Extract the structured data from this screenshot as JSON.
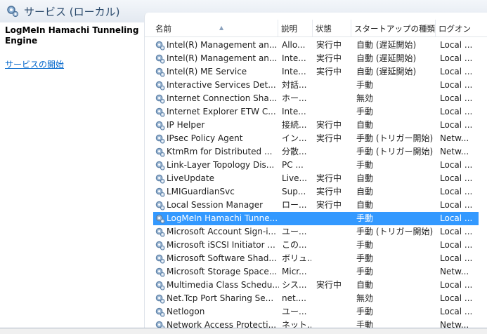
{
  "window": {
    "title": "サービス (ローカル)"
  },
  "left_pane": {
    "service_name": "LogMeIn Hamachi Tunneling Engine",
    "start_link": "サービスの開始"
  },
  "columns": {
    "name": "名前",
    "description": "説明",
    "state": "状態",
    "startup": "スタートアップの種類",
    "logon": "ログオン"
  },
  "services": [
    {
      "name": "Intel(R) Management an...",
      "desc": "Allo...",
      "state": "実行中",
      "startup": "自動 (遅延開始)",
      "logon": "Local ..."
    },
    {
      "name": "Intel(R) Management an...",
      "desc": "Inte...",
      "state": "実行中",
      "startup": "自動 (遅延開始)",
      "logon": "Local ..."
    },
    {
      "name": "Intel(R) ME Service",
      "desc": "Inte...",
      "state": "実行中",
      "startup": "自動 (遅延開始)",
      "logon": "Local ..."
    },
    {
      "name": "Interactive Services Det...",
      "desc": "対話...",
      "state": "",
      "startup": "手動",
      "logon": "Local ..."
    },
    {
      "name": "Internet Connection Sha...",
      "desc": "ホー...",
      "state": "",
      "startup": "無効",
      "logon": "Local ..."
    },
    {
      "name": "Internet Explorer ETW C...",
      "desc": "Inte...",
      "state": "",
      "startup": "手動",
      "logon": "Local ..."
    },
    {
      "name": "IP Helper",
      "desc": "接続...",
      "state": "実行中",
      "startup": "自動",
      "logon": "Local ..."
    },
    {
      "name": "IPsec Policy Agent",
      "desc": "イン...",
      "state": "実行中",
      "startup": "手動 (トリガー開始)",
      "logon": "Netw..."
    },
    {
      "name": "KtmRm for Distributed ...",
      "desc": "分散...",
      "state": "",
      "startup": "手動 (トリガー開始)",
      "logon": "Netw..."
    },
    {
      "name": "Link-Layer Topology Dis...",
      "desc": "PC ...",
      "state": "",
      "startup": "手動",
      "logon": "Local ..."
    },
    {
      "name": "LiveUpdate",
      "desc": "Live...",
      "state": "実行中",
      "startup": "自動",
      "logon": "Local ..."
    },
    {
      "name": "LMIGuardianSvc",
      "desc": "Sup...",
      "state": "実行中",
      "startup": "自動",
      "logon": "Local ..."
    },
    {
      "name": "Local Session Manager",
      "desc": "ロー...",
      "state": "実行中",
      "startup": "自動",
      "logon": "Local ..."
    },
    {
      "name": "LogMeIn Hamachi Tunne...",
      "desc": "",
      "state": "",
      "startup": "手動",
      "logon": "Local ...",
      "selected": true
    },
    {
      "name": "Microsoft Account Sign-i...",
      "desc": "ユー...",
      "state": "",
      "startup": "手動 (トリガー開始)",
      "logon": "Local ..."
    },
    {
      "name": "Microsoft iSCSI Initiator ...",
      "desc": "この...",
      "state": "",
      "startup": "手動",
      "logon": "Local ..."
    },
    {
      "name": "Microsoft Software Shad...",
      "desc": "ボリュ...",
      "state": "",
      "startup": "手動",
      "logon": "Local ..."
    },
    {
      "name": "Microsoft Storage Space...",
      "desc": "Micr...",
      "state": "",
      "startup": "手動",
      "logon": "Netw..."
    },
    {
      "name": "Multimedia Class Schedu...",
      "desc": "シス...",
      "state": "実行中",
      "startup": "自動",
      "logon": "Local ..."
    },
    {
      "name": "Net.Tcp Port Sharing Se...",
      "desc": "net....",
      "state": "",
      "startup": "無効",
      "logon": "Local ..."
    },
    {
      "name": "Netlogon",
      "desc": "ユー...",
      "state": "",
      "startup": "手動",
      "logon": "Local ..."
    },
    {
      "name": "Network Access Protecti...",
      "desc": "ネット...",
      "state": "",
      "startup": "手動",
      "logon": "Netw..."
    }
  ],
  "icons": {
    "header": "services-gear-icon",
    "row": "service-gear-icon"
  },
  "colors": {
    "selection": "#3399ff",
    "link": "#0066cc",
    "title_text": "#2b4a6c"
  }
}
